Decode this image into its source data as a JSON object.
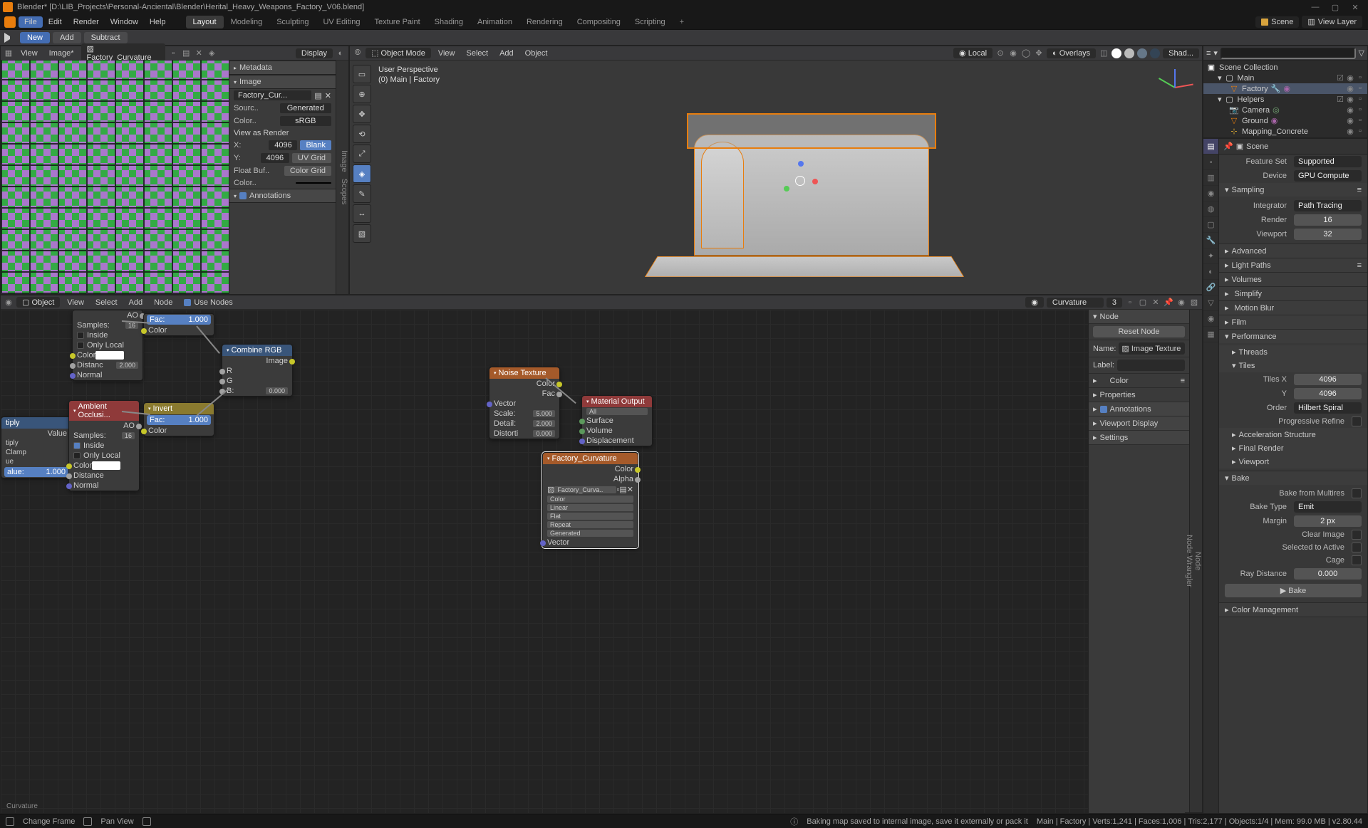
{
  "title": "Blender* [D:\\LIB_Projects\\Personal-Anciental\\Blender\\Herital_Heavy_Weapons_Factory_V06.blend]",
  "menu": {
    "items": [
      "File",
      "Edit",
      "Render",
      "Window",
      "Help"
    ]
  },
  "workspaces": [
    "Layout",
    "Modeling",
    "Sculpting",
    "UV Editing",
    "Texture Paint",
    "Shading",
    "Animation",
    "Rendering",
    "Compositing",
    "Scripting"
  ],
  "workspace_active": "Layout",
  "scene_field": "Scene",
  "viewlayer_field": "View Layer",
  "toolrow": {
    "new": "New",
    "add": "Add",
    "subtract": "Subtract"
  },
  "uv": {
    "menus": [
      "View",
      "Image*"
    ],
    "image_name": "Factory_Curvature",
    "display": "Display",
    "side": {
      "metadata": "Metadata",
      "image": "Image",
      "img_field": "Factory_Cur...",
      "source_lbl": "Sourc..",
      "source": "Generated",
      "color_lbl": "Color..",
      "color": "sRGB",
      "view_as_render": "View as Render",
      "x_lbl": "X:",
      "x": "4096",
      "y_lbl": "Y:",
      "y": "4096",
      "blank": "Blank",
      "uvgrid": "UV Grid",
      "colorgrid": "Color Grid",
      "float_lbl": "Float Buf..",
      "color2_lbl": "Color..",
      "annotations": "Annotations"
    },
    "scopes_tab": "Scopes",
    "image_tab": "Image"
  },
  "viewport": {
    "mode": "Object Mode",
    "menus": [
      "View",
      "Select",
      "Add",
      "Object"
    ],
    "orient": "Local",
    "overlays": "Overlays",
    "shading": "Shad...",
    "info1": "User Perspective",
    "info2": "(0) Main | Factory"
  },
  "outliner": {
    "scene_collection": "Scene Collection",
    "items": [
      {
        "name": "Main",
        "type": "coll",
        "depth": 1,
        "expanded": true
      },
      {
        "name": "Factory",
        "type": "mesh",
        "depth": 2,
        "sel": true
      },
      {
        "name": "Helpers",
        "type": "coll",
        "depth": 1,
        "expanded": true
      },
      {
        "name": "Camera",
        "type": "cam",
        "depth": 2
      },
      {
        "name": "Ground",
        "type": "mesh",
        "depth": 2
      },
      {
        "name": "Mapping_Concrete",
        "type": "empty",
        "depth": 2
      }
    ]
  },
  "props": {
    "context": "Scene",
    "feature_set_lbl": "Feature Set",
    "feature_set": "Supported",
    "device_lbl": "Device",
    "device": "GPU Compute",
    "sampling": "Sampling",
    "integrator_lbl": "Integrator",
    "integrator": "Path Tracing",
    "render_lbl": "Render",
    "render": "16",
    "viewport_lbl": "Viewport",
    "viewport": "32",
    "advanced": "Advanced",
    "light_paths": "Light Paths",
    "volumes": "Volumes",
    "simplify": "Simplify",
    "motion_blur": "Motion Blur",
    "film": "Film",
    "performance": "Performance",
    "threads": "Threads",
    "tiles": "Tiles",
    "tiles_x_lbl": "Tiles X",
    "tiles_x": "4096",
    "tiles_y_lbl": "Y",
    "tiles_y": "4096",
    "order_lbl": "Order",
    "order": "Hilbert Spiral",
    "prog_refine": "Progressive Refine",
    "accel": "Acceleration Structure",
    "final_render": "Final Render",
    "viewport2": "Viewport",
    "bake": "Bake",
    "bake_multires": "Bake from Multires",
    "bake_type_lbl": "Bake Type",
    "bake_type": "Emit",
    "margin_lbl": "Margin",
    "margin": "2 px",
    "clear_image": "Clear Image",
    "sel_to_active": "Selected to Active",
    "cage": "Cage",
    "ray_dist_lbl": "Ray Distance",
    "ray_dist": "0.000",
    "bake_btn": "Bake",
    "color_mgmt": "Color Management"
  },
  "nodes": {
    "menus": [
      "View",
      "Select",
      "Add",
      "Node"
    ],
    "type_dd": "Object",
    "use_nodes": "Use Nodes",
    "material": "Curvature",
    "users": "3",
    "breadcrumb": "Curvature",
    "side": {
      "node": "Node",
      "reset": "Reset Node",
      "name_lbl": "Name:",
      "name": "Image Texture",
      "label_lbl": "Label:",
      "color": "Color",
      "properties": "Properties",
      "annotations": "Annotations",
      "viewport_display": "Viewport Display",
      "settings": "Settings",
      "tab_node": "Node",
      "tab_nw": "Node Wrangler"
    },
    "n": {
      "ao1": {
        "title": "",
        "ao": "AO",
        "samples": "Samples:",
        "samples_v": "16",
        "inside": "Inside",
        "only_local": "Only Local",
        "color": "Color",
        "distance": "Distanc",
        "distance_v": "2.000",
        "normal": "Normal"
      },
      "ao2": {
        "title": "Ambient Occlusi...",
        "ao": "AO",
        "samples": "Samples:",
        "samples_v": "16",
        "inside": "Inside",
        "only_local": "Only Local",
        "color": "Color",
        "distance": "Distance",
        "normal": "Normal"
      },
      "mult": {
        "title": "tiply",
        "value": "Value",
        "tiply": "tiply",
        "clamp": "Clamp",
        "ue": "ue",
        "alue": "alue:",
        "alue_v": "1.000"
      },
      "inv1": {
        "title": "",
        "fac": "Fac:",
        "fac_v": "1.000",
        "color": "Color"
      },
      "inv2": {
        "title": "Invert",
        "fac": "Fac:",
        "fac_v": "1.000",
        "color": "Color"
      },
      "comb": {
        "title": "Combine RGB",
        "image": "Image",
        "r": "R",
        "g": "G",
        "b": "B:",
        "b_v": "0.000"
      },
      "noise": {
        "title": "Noise Texture",
        "color": "Color",
        "fac": "Fac",
        "vector": "Vector",
        "scale": "Scale:",
        "scale_v": "5.000",
        "detail": "Detail:",
        "detail_v": "2.000",
        "distort": "Distorti",
        "distort_v": "0.000"
      },
      "matout": {
        "title": "Material Output",
        "all": "All",
        "surface": "Surface",
        "volume": "Volume",
        "disp": "Displacement"
      },
      "imgtex": {
        "title": "Factory_Curvature",
        "color": "Color",
        "alpha": "Alpha",
        "img": "Factory_Curva..",
        "colsp": "Color",
        "interp": "Linear",
        "proj": "Flat",
        "ext": "Repeat",
        "src": "Generated",
        "vector": "Vector"
      }
    }
  },
  "status": {
    "change_frame": "Change Frame",
    "pan_view": "Pan View",
    "msg": "Baking map saved to internal image, save it externally or pack it",
    "stats": "Main | Factory | Verts:1,241 | Faces:1,006 | Tris:2,177 | Objects:1/4 | Mem: 99.0 MB | v2.80.44"
  }
}
